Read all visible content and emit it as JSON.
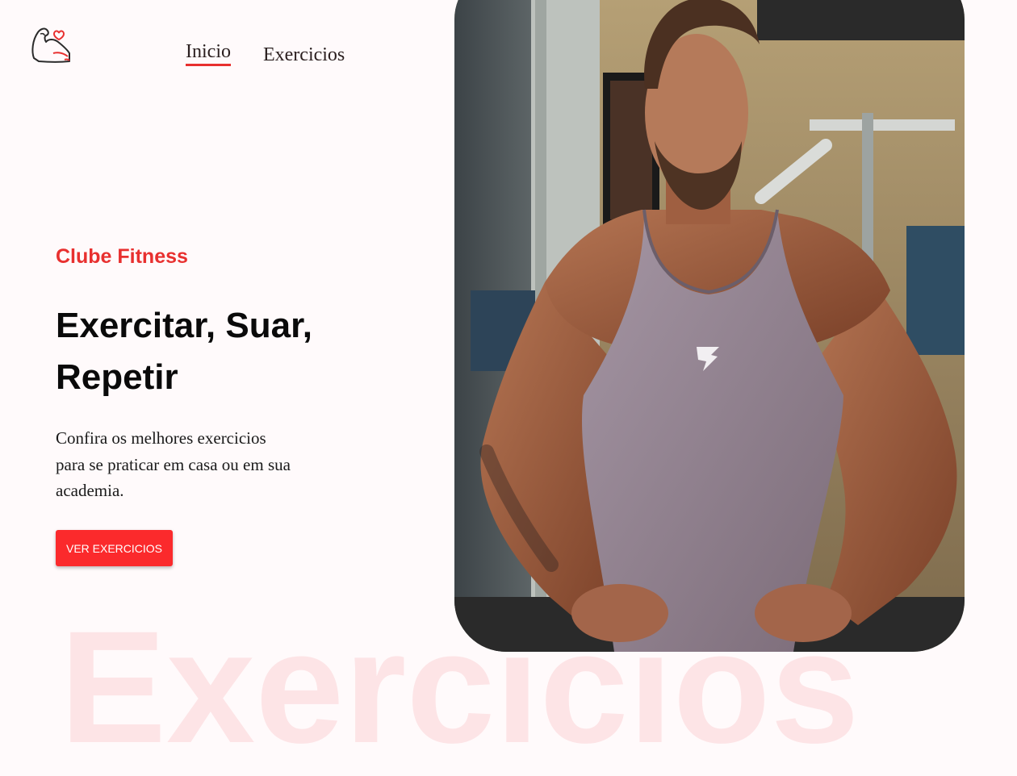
{
  "header": {
    "logo_icon": "flexed-bicep-heart-icon",
    "nav": [
      {
        "label": "Inicio",
        "active": true
      },
      {
        "label": "Exercicios",
        "active": false
      }
    ]
  },
  "hero": {
    "subtitle": "Clube Fitness",
    "headline": "Exercitar, Suar, Repetir",
    "description": "Confira os melhores exercicios para se praticar em casa ou em sua academia.",
    "cta_label": "VER EXERCICIOS",
    "watermark": "Exercicios",
    "image_icon": "athlete-photo"
  },
  "colors": {
    "accent": "#e8302f",
    "button": "#fb2a2c",
    "background": "#fffafb",
    "watermark": "#fde4e6"
  }
}
